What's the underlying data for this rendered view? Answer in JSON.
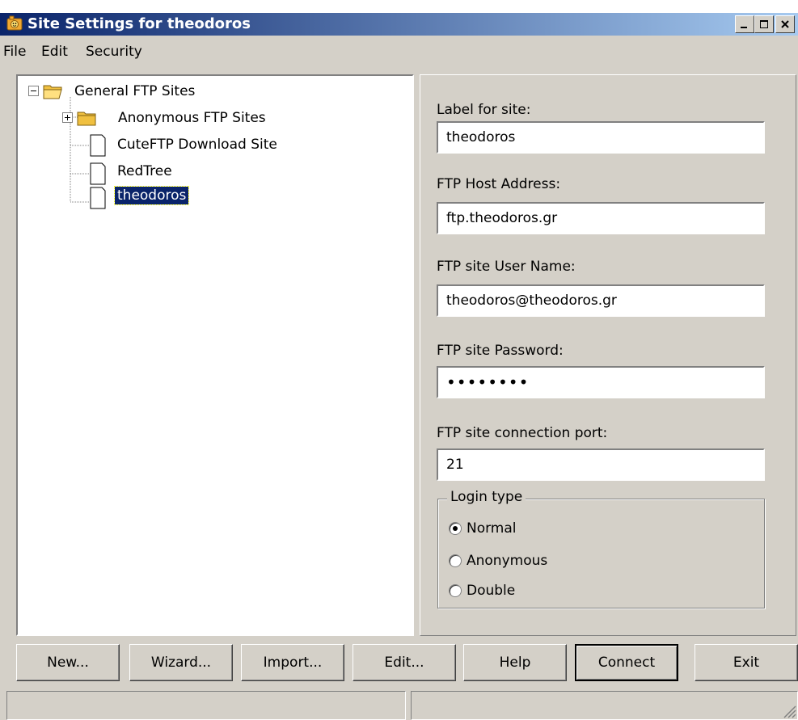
{
  "window": {
    "title": "Site Settings for theodoros"
  },
  "menu": [
    "File",
    "Edit",
    "Security"
  ],
  "tree": {
    "root": "General FTP Sites",
    "children": [
      {
        "label": "Anonymous FTP Sites"
      },
      {
        "label": "CuteFTP Download Site"
      },
      {
        "label": "RedTree"
      },
      {
        "label": "theodoros"
      }
    ]
  },
  "form": {
    "label_caption": "Label for site:",
    "label_value": "theodoros",
    "host_caption": "FTP Host Address:",
    "host_value": "ftp.theodoros.gr",
    "user_caption": "FTP site User Name:",
    "user_value": "theodoros@theodoros.gr",
    "password_caption": "FTP site Password:",
    "password_value": "••••••••",
    "port_caption": "FTP site connection port:",
    "port_value": "21",
    "login_type": {
      "legend": "Login type",
      "options": [
        "Normal",
        "Anonymous",
        "Double"
      ],
      "selected": "Normal"
    }
  },
  "buttons": {
    "new": "New...",
    "wizard": "Wizard...",
    "import": "Import...",
    "edit": "Edit...",
    "help": "Help",
    "connect": "Connect",
    "exit": "Exit"
  }
}
